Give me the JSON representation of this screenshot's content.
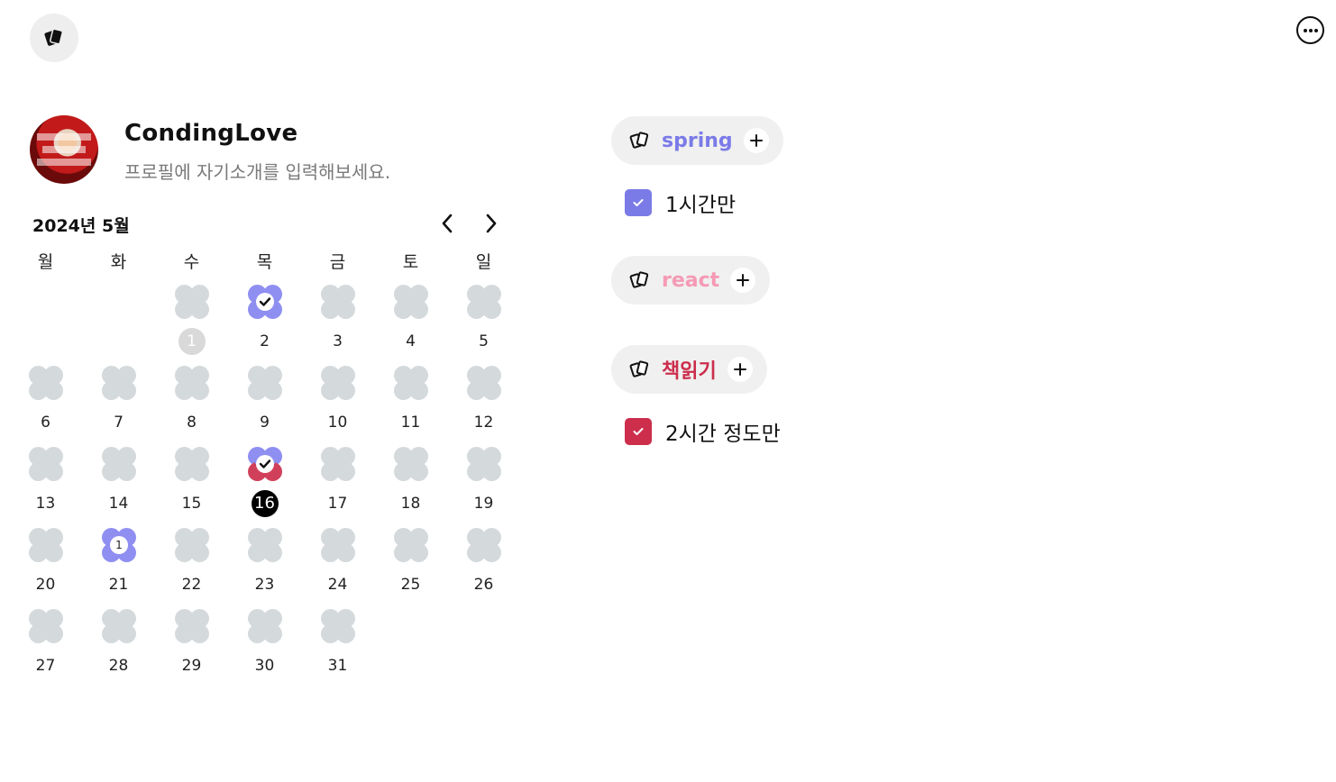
{
  "header": {
    "app_icon": "cards-icon",
    "more_icon": "more-horizontal-icon"
  },
  "profile": {
    "username": "CondingLove",
    "bio_placeholder": "프로필에 자기소개를 입력해보세요."
  },
  "calendar": {
    "month_label": "2024년 5월",
    "weekdays": [
      "월",
      "화",
      "수",
      "목",
      "금",
      "토",
      "일"
    ],
    "leading_blanks": 2,
    "days": [
      {
        "day": "1",
        "style": "gray",
        "clover": "gray"
      },
      {
        "day": "2",
        "clover": "purple",
        "badge": "check"
      },
      {
        "day": "3"
      },
      {
        "day": "4"
      },
      {
        "day": "5"
      },
      {
        "day": "6"
      },
      {
        "day": "7"
      },
      {
        "day": "8"
      },
      {
        "day": "9"
      },
      {
        "day": "10"
      },
      {
        "day": "11"
      },
      {
        "day": "12"
      },
      {
        "day": "13"
      },
      {
        "day": "14"
      },
      {
        "day": "15"
      },
      {
        "day": "16",
        "style": "today",
        "clover": "split",
        "badge": "check"
      },
      {
        "day": "17"
      },
      {
        "day": "18"
      },
      {
        "day": "19"
      },
      {
        "day": "20"
      },
      {
        "day": "21",
        "clover": "purple",
        "badge": "1"
      },
      {
        "day": "22"
      },
      {
        "day": "23"
      },
      {
        "day": "24"
      },
      {
        "day": "25"
      },
      {
        "day": "26"
      },
      {
        "day": "27"
      },
      {
        "day": "28"
      },
      {
        "day": "29"
      },
      {
        "day": "30"
      },
      {
        "day": "31"
      }
    ],
    "clover_colors": {
      "gray": "#d4d9dc",
      "purple": "#8f8ff2",
      "red": "#d1405b"
    }
  },
  "goals": [
    {
      "name": "spring",
      "color": "#7b7be8",
      "todos": [
        {
          "text": "1시간만",
          "checked": true,
          "color": "#7b7be8"
        }
      ]
    },
    {
      "name": "react",
      "color": "#f59ab5",
      "todos": []
    },
    {
      "name": "책읽기",
      "color": "#cc2e4c",
      "todos": [
        {
          "text": "2시간 정도만",
          "checked": true,
          "color": "#cc2e4c"
        }
      ]
    }
  ]
}
